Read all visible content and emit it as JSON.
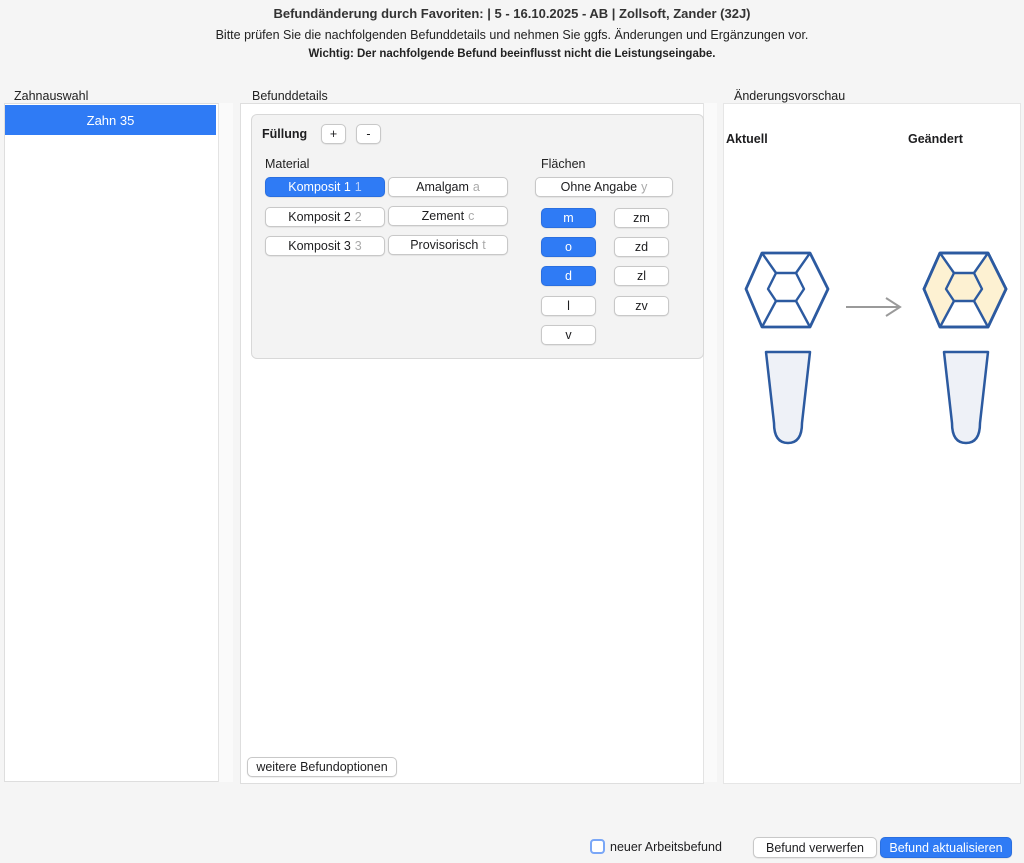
{
  "header": {
    "title": "Befundänderung durch Favoriten: | 5 - 16.10.2025 - AB  | Zollsoft, Zander (32J)",
    "instruction": "Bitte prüfen Sie die nachfolgenden Befunddetails und nehmen Sie ggfs. Änderungen und Ergänzungen vor.",
    "warning": "Wichtig: Der nachfolgende Befund beeinflusst nicht die Leistungseingabe."
  },
  "zahnauswahl": {
    "label": "Zahnauswahl",
    "items": [
      "Zahn 35"
    ]
  },
  "befunddetails": {
    "label": "Befunddetails",
    "group_title": "Füllung",
    "add_label": "+",
    "remove_label": "-",
    "material_label": "Material",
    "materials": [
      {
        "label": "Komposit 1",
        "key": "1",
        "selected": true
      },
      {
        "label": "Amalgam",
        "key": "a",
        "selected": false
      },
      {
        "label": "Komposit 2",
        "key": "2",
        "selected": false
      },
      {
        "label": "Zement",
        "key": "c",
        "selected": false
      },
      {
        "label": "Komposit 3",
        "key": "3",
        "selected": false
      },
      {
        "label": "Provisorisch",
        "key": "t",
        "selected": false
      }
    ],
    "flaechen_label": "Flächen",
    "ohne_angabe": {
      "label": "Ohne Angabe",
      "key": "y"
    },
    "surfaces": [
      {
        "label": "m",
        "selected": true
      },
      {
        "label": "zm",
        "selected": false
      },
      {
        "label": "o",
        "selected": true
      },
      {
        "label": "zd",
        "selected": false
      },
      {
        "label": "d",
        "selected": true
      },
      {
        "label": "zl",
        "selected": false
      },
      {
        "label": "l",
        "selected": false
      },
      {
        "label": "zv",
        "selected": false
      },
      {
        "label": "v",
        "selected": false
      }
    ],
    "weitere_label": "weitere Befundoptionen"
  },
  "vorschau": {
    "label": "Änderungsvorschau",
    "current_label": "Aktuell",
    "changed_label": "Geändert",
    "outline_color": "#2c5aa0",
    "fill_color": "#fdf1d2",
    "root_fill": "#eef1f7"
  },
  "footer": {
    "checkbox_label": "neuer Arbeitsbefund",
    "discard_label": "Befund verwerfen",
    "update_label": "Befund aktualisieren"
  }
}
